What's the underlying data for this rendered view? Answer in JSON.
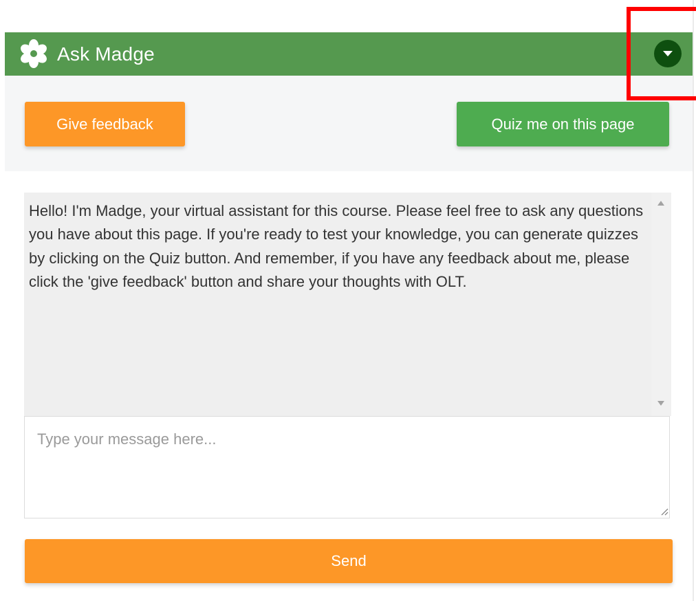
{
  "header": {
    "title": "Ask Madge",
    "icon": "flower-icon",
    "collapse_icon": "caret-down-icon",
    "color": "#55994f"
  },
  "toolbar": {
    "feedback_label": "Give feedback",
    "quiz_label": "Quiz me on this page"
  },
  "chat": {
    "messages": [
      {
        "text": "Hello! I'm Madge, your virtual assistant for this course. Please feel free to ask any questions you have about this page. If you're ready to test your knowledge, you can generate quizzes by clicking on the Quiz button. And remember, if you have any feedback about me, please click the 'give feedback' button and share your thoughts with OLT."
      }
    ]
  },
  "input": {
    "placeholder": "Type your message here...",
    "value": ""
  },
  "send": {
    "label": "Send"
  },
  "colors": {
    "orange": "#fd9727",
    "green": "#4eac50",
    "dark_green": "#0e4f0f",
    "highlight": "#ff0000"
  }
}
